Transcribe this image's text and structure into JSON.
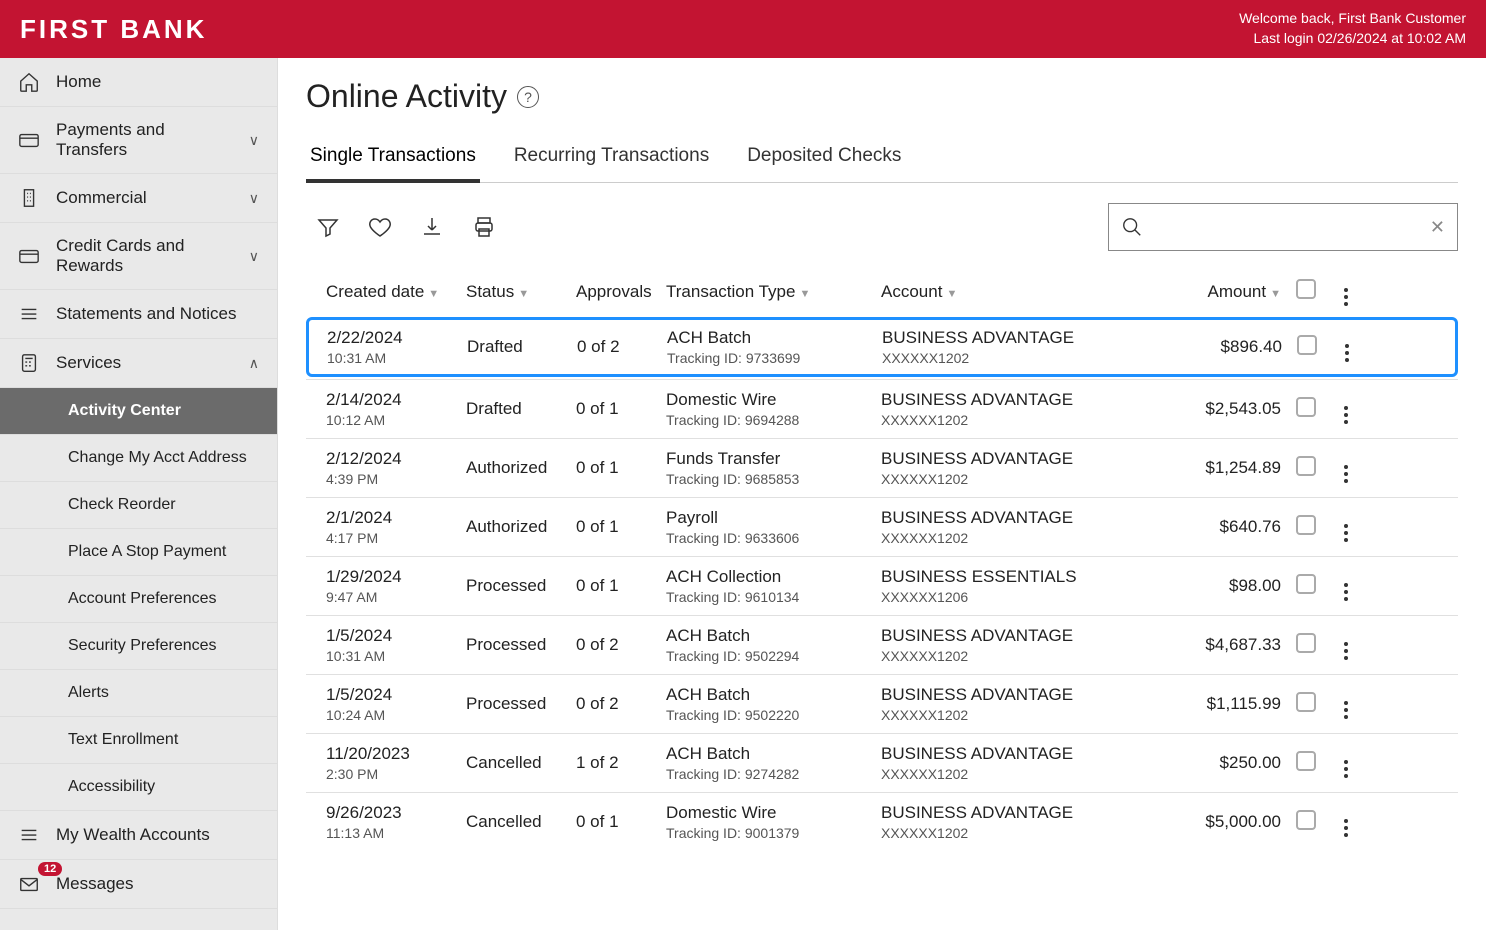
{
  "header": {
    "logo": "FIRST BANK",
    "welcome_line1": "Welcome back, First Bank Customer",
    "welcome_line2": "Last login 02/26/2024 at 10:02 AM"
  },
  "sidebar": {
    "items": [
      {
        "label": "Home",
        "icon": "home",
        "expandable": false
      },
      {
        "label": "Payments and Transfers",
        "icon": "card",
        "expandable": true,
        "open": false
      },
      {
        "label": "Commercial",
        "icon": "building",
        "expandable": true,
        "open": false
      },
      {
        "label": "Credit Cards and Rewards",
        "icon": "card",
        "expandable": true,
        "open": false
      },
      {
        "label": "Statements and Notices",
        "icon": "lines",
        "expandable": false
      },
      {
        "label": "Services",
        "icon": "calc",
        "expandable": true,
        "open": true,
        "children": [
          {
            "label": "Activity Center",
            "active": true
          },
          {
            "label": "Change My Acct Address"
          },
          {
            "label": "Check Reorder"
          },
          {
            "label": "Place A Stop Payment"
          },
          {
            "label": "Account Preferences"
          },
          {
            "label": "Security Preferences"
          },
          {
            "label": "Alerts"
          },
          {
            "label": "Text Enrollment"
          },
          {
            "label": "Accessibility"
          }
        ]
      },
      {
        "label": "My Wealth Accounts",
        "icon": "lines",
        "expandable": false
      },
      {
        "label": "Messages",
        "icon": "mail",
        "badge": "12",
        "expandable": false
      }
    ]
  },
  "page": {
    "title": "Online Activity",
    "tabs": [
      "Single Transactions",
      "Recurring Transactions",
      "Deposited Checks"
    ],
    "active_tab": 0
  },
  "columns": {
    "created": "Created date",
    "status": "Status",
    "approvals": "Approvals",
    "type": "Transaction Type",
    "account": "Account",
    "amount": "Amount"
  },
  "rows": [
    {
      "date": "2/22/2024",
      "time": "10:31 AM",
      "status": "Drafted",
      "approvals": "0 of 2",
      "type": "ACH Batch",
      "tracking": "Tracking ID: 9733699",
      "account": "BUSINESS ADVANTAGE",
      "acctnum": "XXXXXX1202",
      "amount": "$896.40",
      "highlighted": true
    },
    {
      "date": "2/14/2024",
      "time": "10:12 AM",
      "status": "Drafted",
      "approvals": "0 of 1",
      "type": "Domestic Wire",
      "tracking": "Tracking ID: 9694288",
      "account": "BUSINESS ADVANTAGE",
      "acctnum": "XXXXXX1202",
      "amount": "$2,543.05"
    },
    {
      "date": "2/12/2024",
      "time": "4:39 PM",
      "status": "Authorized",
      "approvals": "0 of 1",
      "type": "Funds Transfer",
      "tracking": "Tracking ID: 9685853",
      "account": "BUSINESS ADVANTAGE",
      "acctnum": "XXXXXX1202",
      "amount": "$1,254.89"
    },
    {
      "date": "2/1/2024",
      "time": "4:17 PM",
      "status": "Authorized",
      "approvals": "0 of 1",
      "type": "Payroll",
      "tracking": "Tracking ID: 9633606",
      "account": "BUSINESS ADVANTAGE",
      "acctnum": "XXXXXX1202",
      "amount": "$640.76"
    },
    {
      "date": "1/29/2024",
      "time": "9:47 AM",
      "status": "Processed",
      "approvals": "0 of 1",
      "type": "ACH Collection",
      "tracking": "Tracking ID: 9610134",
      "account": "BUSINESS ESSENTIALS",
      "acctnum": "XXXXXX1206",
      "amount": "$98.00"
    },
    {
      "date": "1/5/2024",
      "time": "10:31 AM",
      "status": "Processed",
      "approvals": "0 of 2",
      "type": "ACH Batch",
      "tracking": "Tracking ID: 9502294",
      "account": "BUSINESS ADVANTAGE",
      "acctnum": "XXXXXX1202",
      "amount": "$4,687.33"
    },
    {
      "date": "1/5/2024",
      "time": "10:24 AM",
      "status": "Processed",
      "approvals": "0 of 2",
      "type": "ACH Batch",
      "tracking": "Tracking ID: 9502220",
      "account": "BUSINESS ADVANTAGE",
      "acctnum": "XXXXXX1202",
      "amount": "$1,115.99"
    },
    {
      "date": "11/20/2023",
      "time": "2:30 PM",
      "status": "Cancelled",
      "approvals": "1 of 2",
      "type": "ACH Batch",
      "tracking": "Tracking ID: 9274282",
      "account": "BUSINESS ADVANTAGE",
      "acctnum": "XXXXXX1202",
      "amount": "$250.00"
    },
    {
      "date": "9/26/2023",
      "time": "11:13 AM",
      "status": "Cancelled",
      "approvals": "0 of 1",
      "type": "Domestic Wire",
      "tracking": "Tracking ID: 9001379",
      "account": "BUSINESS ADVANTAGE",
      "acctnum": "XXXXXX1202",
      "amount": "$5,000.00"
    }
  ]
}
